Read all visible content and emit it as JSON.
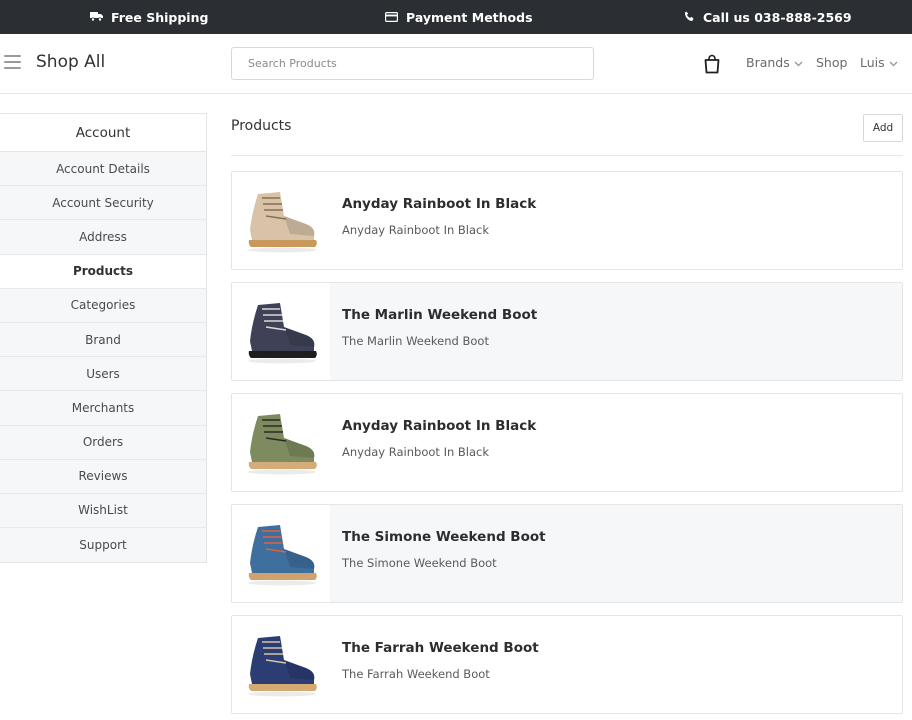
{
  "topbar": {
    "shipping": "Free Shipping",
    "payment": "Payment Methods",
    "call": "Call us 038-888-2569"
  },
  "header": {
    "brand": "Shop All",
    "search_placeholder": "Search Products",
    "nav": {
      "brands": "Brands",
      "shop": "Shop",
      "user": "Luis"
    }
  },
  "sidebar": {
    "title": "Account",
    "active": "Products",
    "items": [
      {
        "label": "Account Details"
      },
      {
        "label": "Account Security"
      },
      {
        "label": "Address"
      },
      {
        "label": "Products"
      },
      {
        "label": "Categories"
      },
      {
        "label": "Brand"
      },
      {
        "label": "Users"
      },
      {
        "label": "Merchants"
      },
      {
        "label": "Orders"
      },
      {
        "label": "Reviews"
      },
      {
        "label": "WishList"
      },
      {
        "label": "Support"
      }
    ]
  },
  "main": {
    "title": "Products",
    "add_label": "Add",
    "products": [
      {
        "name": "Anyday Rainboot In Black",
        "subtitle": "Anyday Rainboot In Black",
        "upper": "#d9c3a8",
        "sole": "#c9995b",
        "laces": "#8a6d52"
      },
      {
        "name": "The Marlin Weekend Boot",
        "subtitle": "The Marlin Weekend Boot",
        "upper": "#3f4256",
        "sole": "#1e1e1e",
        "laces": "#d9d9d9"
      },
      {
        "name": "Anyday Rainboot In Black",
        "subtitle": "Anyday Rainboot In Black",
        "upper": "#7d8b5e",
        "sole": "#d5ab7a",
        "laces": "#2a2a2a"
      },
      {
        "name": "The Simone Weekend Boot",
        "subtitle": "The Simone Weekend Boot",
        "upper": "#3f6f9e",
        "sole": "#d2a26c",
        "laces": "#e0603f"
      },
      {
        "name": "The Farrah Weekend Boot",
        "subtitle": "The Farrah Weekend Boot",
        "upper": "#2c3d73",
        "sole": "#d4aa73",
        "laces": "#d8c4a4"
      }
    ]
  },
  "colors": {
    "topbar": "#2b2f33",
    "sidebar_bg": "#f6f7f8",
    "border": "#e5e5e5"
  }
}
